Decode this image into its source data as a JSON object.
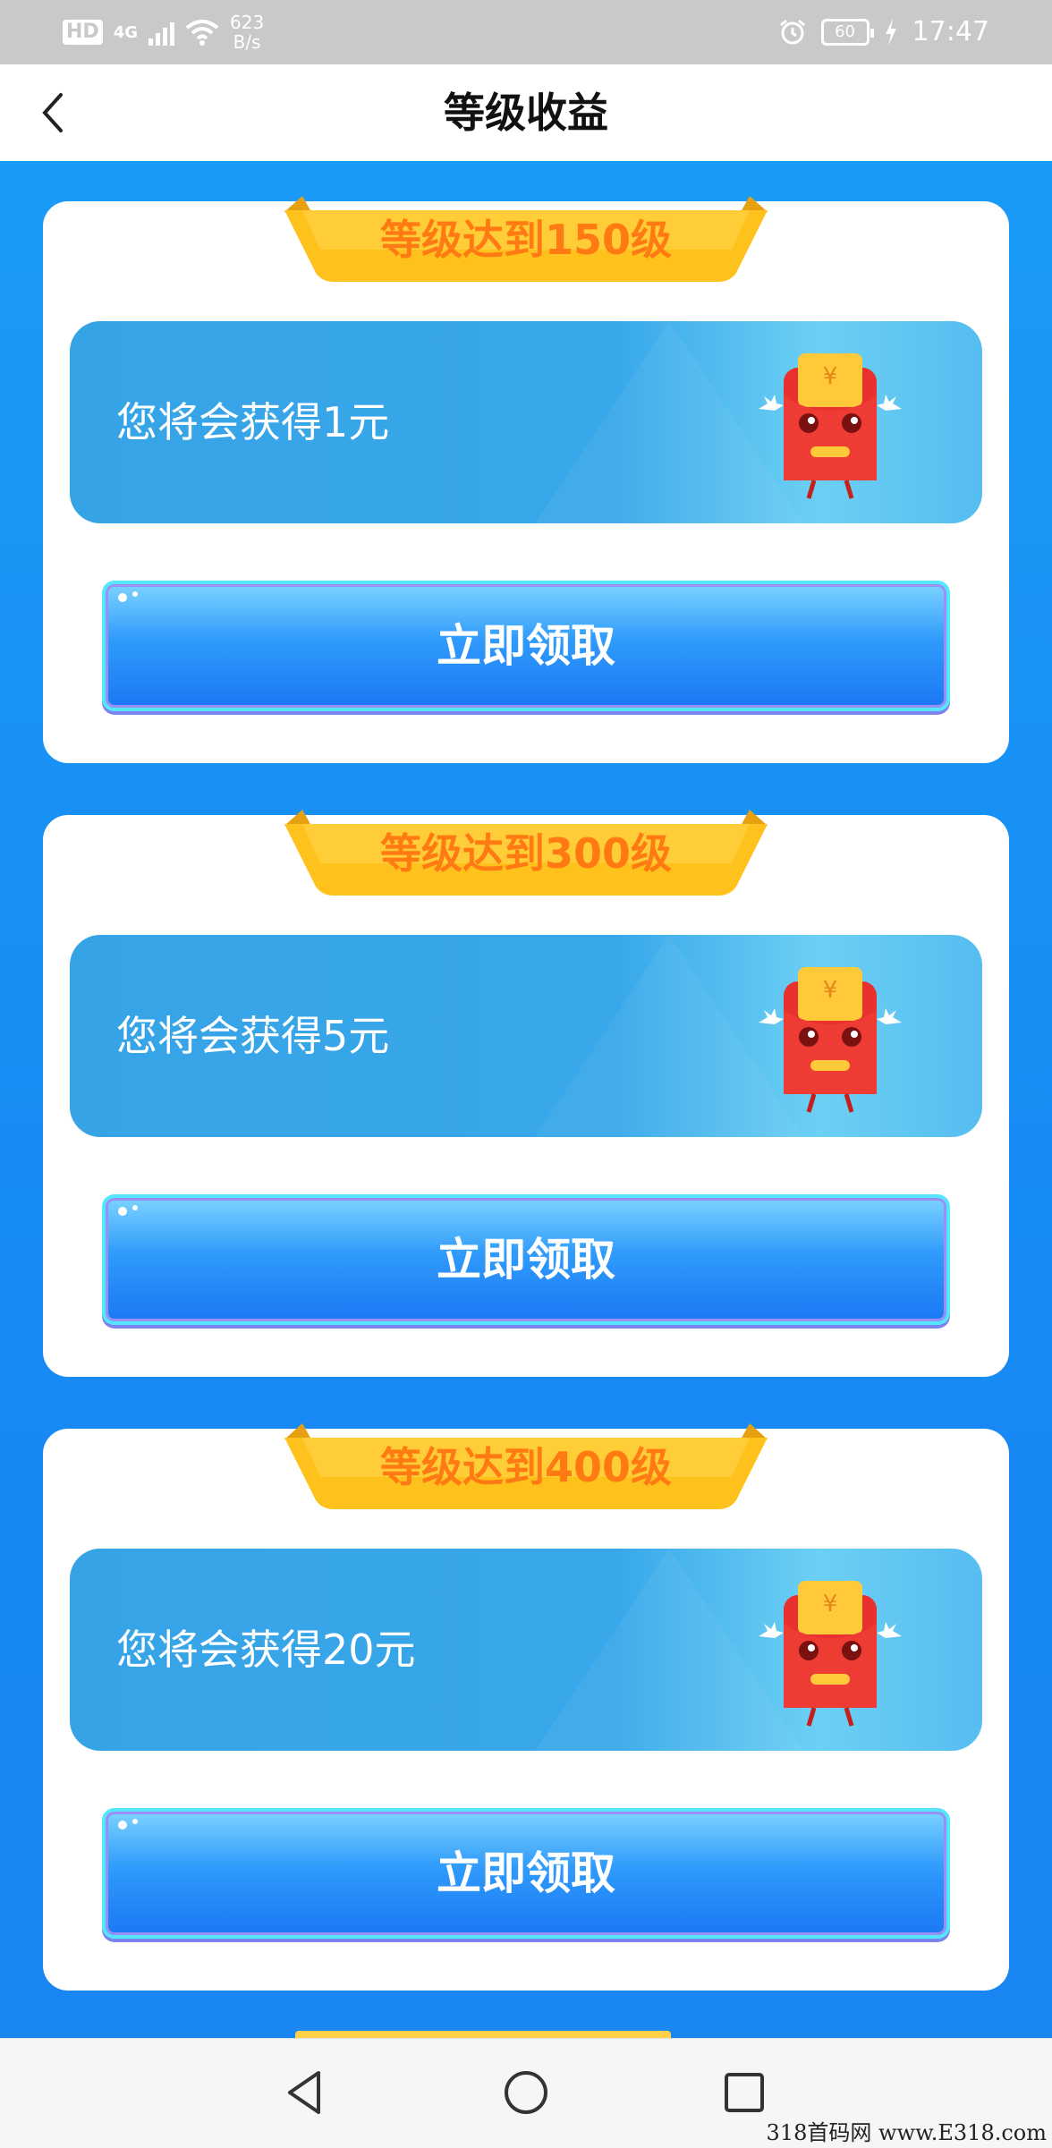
{
  "status_bar": {
    "hd": "HD",
    "network": "4G",
    "speed_value": "623",
    "speed_unit": "B/s",
    "battery": "60",
    "time": "17:47"
  },
  "header": {
    "title": "等级收益",
    "back_icon": "chevron-left-icon"
  },
  "rewards": [
    {
      "level_label": "等级达到150级",
      "reward_text": "您将会获得1元",
      "button_label": "立即领取"
    },
    {
      "level_label": "等级达到300级",
      "reward_text": "您将会获得5元",
      "button_label": "立即领取"
    },
    {
      "level_label": "等级达到400级",
      "reward_text": "您将会获得20元",
      "button_label": "立即领取"
    }
  ],
  "nav": {
    "back_icon": "triangle-back-icon",
    "home_icon": "circle-home-icon",
    "recents_icon": "square-recents-icon"
  },
  "watermark": "318首码网 www.E318.com",
  "colors": {
    "background_blue": "#1b8ef5",
    "ribbon_text": "#ff7a12",
    "ribbon_gold": "#ffc21d",
    "button_blue": "#1a78f4"
  }
}
